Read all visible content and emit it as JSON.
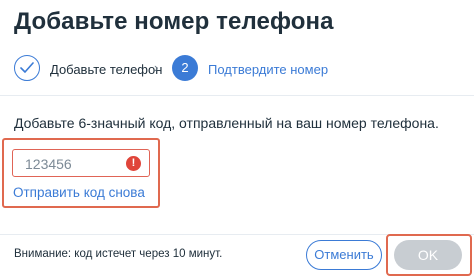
{
  "dialog": {
    "title": "Добавьте номер телефона"
  },
  "stepper": {
    "steps": [
      {
        "label": "Добавьте телефон",
        "state": "completed",
        "icon": "check-icon"
      },
      {
        "label": "Подтвердите номер",
        "number": "2",
        "state": "active"
      }
    ],
    "separator_icon": "chevron-right-icon",
    "separator": "›"
  },
  "instruction": "Добавьте 6-значный код, отправленный на ваш номер телефона.",
  "code_field": {
    "value": "123456",
    "state": "error",
    "error_icon": "!"
  },
  "resend_link": "Отправить код снова",
  "footer": {
    "warning": "Внимание: код истечет через 10 минут.",
    "cancel_label": "Отменить",
    "ok_label": "OK"
  },
  "colors": {
    "accent": "#3b7bd6",
    "error": "#e0453a",
    "highlight": "#e0694f",
    "disabled_button": "#c8cdd2"
  }
}
